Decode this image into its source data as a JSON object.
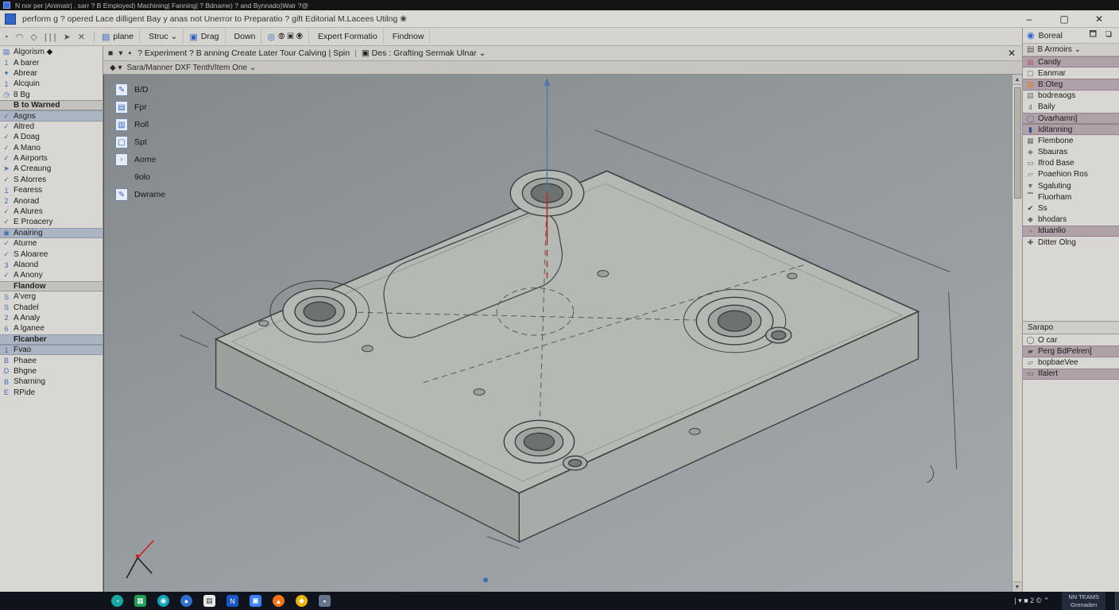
{
  "titlebar": {
    "text": "N nor per |Animatr| , sarr ? B Employed) Machining| Fanning| ? Bdname) ? and Bynnado)Walr  ?@"
  },
  "menubar": {
    "text": "perform g ?  opered Lace dilligent Bay y anas not Unerror to Preparatio   ? gift Editorial M.Lacees Utilng    ❀",
    "minimize": "–",
    "maximize": "▢",
    "close": "✕"
  },
  "toolbar": {
    "sys_icons": "◔ ◠ ◇ ||| ➤ ✕",
    "items": [
      {
        "icon": "▤",
        "label": "plane"
      },
      {
        "icon": "",
        "label": "Struc ⌄"
      },
      {
        "icon": "▣",
        "label": "Drag"
      },
      {
        "icon": "",
        "label": "Down"
      },
      {
        "icon": "◎",
        "label": "⦾ ▣ ⦿"
      },
      {
        "icon": "",
        "label": "Expert Formatio"
      },
      {
        "icon": "",
        "label": "Findnow"
      }
    ]
  },
  "tabbar": {
    "icons": "■ ▾ ▪",
    "text1": "? Experiment ? B anning Create Later Tour Calving | Spin",
    "text2": "▣ Des : Grafting Sermak Ulnar ⌄",
    "close": "✕"
  },
  "subtab": {
    "icons": "◆ ▾",
    "text": "Sara/Manner DXF Tenth/Item One ⌄"
  },
  "viewport_tools": {
    "items": [
      {
        "icon": "✎",
        "label": "B/D"
      },
      {
        "icon": "▤",
        "label": "Fpr"
      },
      {
        "icon": "▥",
        "label": "Roll"
      },
      {
        "icon": "▢",
        "label": "Spt"
      },
      {
        "icon": "▫",
        "label": "Aome"
      },
      {
        "icon": "",
        "label": "9olo"
      },
      {
        "icon": "✎",
        "label": "Dwrame"
      }
    ]
  },
  "scrollbar": {
    "up": "▲",
    "down": "▼"
  },
  "left_panel": {
    "items": [
      {
        "icon": "▤",
        "label": "Algorism ◆"
      },
      {
        "icon": "1",
        "label": "A barer"
      },
      {
        "icon": "✦",
        "label": "Abrear"
      },
      {
        "icon": "1",
        "label": "Alcquin"
      },
      {
        "icon": "◷",
        "label": "8 Bg"
      },
      {
        "type": "header",
        "label": "B to  Warned"
      },
      {
        "icon": "✓",
        "label": "Asgns",
        "hl": true
      },
      {
        "icon": "✓",
        "label": "Altred"
      },
      {
        "icon": "✓",
        "label": "A Doag"
      },
      {
        "icon": "✓",
        "label": "A Mano"
      },
      {
        "icon": "✓",
        "label": "A Airports"
      },
      {
        "icon": "➤",
        "label": "A Creaung"
      },
      {
        "icon": "✓",
        "label": "S Atorres"
      },
      {
        "icon": "1",
        "label": "Fearess"
      },
      {
        "icon": "2",
        "label": "Anorad"
      },
      {
        "icon": "✓",
        "label": "A Alures"
      },
      {
        "icon": "✓",
        "label": "E Proacery"
      },
      {
        "icon": "◉",
        "label": "Anairing",
        "hl": true
      },
      {
        "icon": "✓",
        "label": "Aturne"
      },
      {
        "icon": "✓",
        "label": "S Aloaree"
      },
      {
        "icon": "3",
        "label": "Alaond"
      },
      {
        "icon": "✓",
        "label": "A Anony"
      },
      {
        "type": "header",
        "label": "Flandow"
      },
      {
        "icon": "S",
        "label": "A'verg"
      },
      {
        "icon": "S",
        "label": "Chadel"
      },
      {
        "icon": "2",
        "label": "A Analy"
      },
      {
        "icon": "6",
        "label": "A lganee"
      },
      {
        "type": "header",
        "label": "Flcanber",
        "hl": true
      },
      {
        "icon": "1",
        "label": "Fvao",
        "hl": true
      },
      {
        "icon": "B",
        "label": "Phaee"
      },
      {
        "icon": "D",
        "label": "Bhgne"
      },
      {
        "icon": "B",
        "label": "Sharning"
      },
      {
        "icon": "E",
        "label": "RPide"
      }
    ]
  },
  "right_panel": {
    "title": "Boreal",
    "head_icons": "🗖 ❏",
    "dropdown": "B Armoirs  ⌄",
    "items": [
      {
        "icon": "▦",
        "color": "#b06a78",
        "label": "Candy",
        "hl": true
      },
      {
        "icon": "▢",
        "color": "#6b6b6b",
        "label": "Eanmar"
      },
      {
        "icon": "▥",
        "color": "#d8821e",
        "label": "B:Oteg",
        "hl": true
      },
      {
        "icon": "▤",
        "color": "#6b6b6b",
        "label": "bodreaogs"
      },
      {
        "icon": "4",
        "color": "#6b6b6b",
        "label": "Baily"
      },
      {
        "icon": "◯",
        "color": "#3f6fb0",
        "label": "Ovarhamn]",
        "hl": true
      },
      {
        "icon": "▮",
        "color": "#2f4f8f",
        "label": "Iditanning",
        "hl": true
      },
      {
        "icon": "▦",
        "color": "#6b6b6b",
        "label": "Flembone"
      },
      {
        "icon": "◈",
        "color": "#6b6b6b",
        "label": "Sbauras"
      },
      {
        "icon": "▭",
        "color": "#6b6b6b",
        "label": "Ifrod Base"
      },
      {
        "icon": "▱",
        "color": "#6b6b6b",
        "label": "Poaehion Ros"
      },
      {
        "icon": "▼",
        "color": "#6b6b6b",
        "label": "Sgaluting"
      },
      {
        "icon": "▔",
        "color": "#6b6b6b",
        "label": "Fluorham"
      },
      {
        "icon": "✔",
        "color": "#333333",
        "label": "Ss"
      },
      {
        "icon": "◆",
        "color": "#6b6b6b",
        "label": "bhodars"
      },
      {
        "icon": "◔",
        "color": "#6b6b6b",
        "label": "Iduanlio",
        "hl": true
      },
      {
        "icon": "✚",
        "color": "#555555",
        "label": "Ditter Olng"
      }
    ],
    "section2_title": "Sarapo",
    "items2": [
      {
        "icon": "◯",
        "color": "#555555",
        "label": "O car"
      },
      {
        "icon": "▰",
        "color": "#555555",
        "label": "Perg BdPelren]",
        "hl": true
      },
      {
        "icon": "▱",
        "color": "#555555",
        "label": "bopbaeVee"
      },
      {
        "icon": "▭",
        "color": "#555555",
        "label": "Ifalert",
        "hl": true
      }
    ]
  },
  "taskbar": {
    "apps": [
      {
        "icon": "◔",
        "bg": "#16a8a0",
        "shape": "circle"
      },
      {
        "icon": "▦",
        "bg": "#1e9e57"
      },
      {
        "icon": "◉",
        "bg": "#12a3b8",
        "shape": "circle"
      },
      {
        "icon": "●",
        "bg": "#2f6fd0",
        "shape": "circle"
      },
      {
        "icon": "▤",
        "bg": "#e8e8e8",
        "fg": "#333333"
      },
      {
        "icon": "N",
        "bg": "#1a56c8"
      },
      {
        "icon": "▣",
        "bg": "#3b82f6"
      },
      {
        "icon": "▲",
        "bg": "#f97316",
        "shape": "circle"
      },
      {
        "icon": "◆",
        "bg": "#eab308",
        "shape": "circle"
      },
      {
        "icon": "▪",
        "bg": "#64748b"
      }
    ],
    "tray_text": "| ▾ ■ 2 ©  ⌃",
    "clock_line1": "NN TEAMS",
    "clock_line2": "Grenaden"
  },
  "colors": {
    "accent_blue": "#2f66c8",
    "highlight_left": "#aab4c2",
    "highlight_right": "#b0a0a8",
    "axis_blue": "#5577aa",
    "axis_red": "#cc2222"
  }
}
